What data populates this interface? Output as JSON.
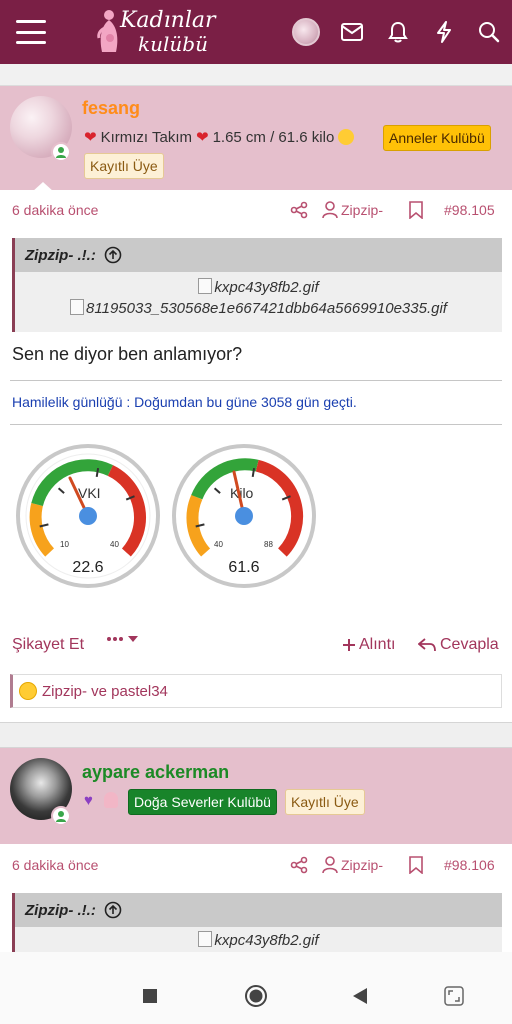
{
  "header": {
    "logo_line1": "Kadınlar",
    "logo_line2": "kulübü"
  },
  "posts": [
    {
      "username": "fesang",
      "username_color": "#ff8c1a",
      "title_text": "Kırmızı Takım",
      "title_stats": "1.65 cm / 61.6 kilo",
      "badges": [
        "Anneler Kulübü",
        "Kayıtlı Üye"
      ],
      "time": "6 dakika önce",
      "tagged_user": "Zipzip-",
      "post_number": "#98.105",
      "quote": {
        "author": "Zipzip- .!.:",
        "images": [
          "kxpc43y8fb2.gif",
          "81195033_530568e1e667421dbb64a5669910e335.gif"
        ]
      },
      "message": "Sen ne diyor ben anlamıyor?",
      "signature": "Hamilelik günlüğü : Doğumdan bu güne 3058 gün geçti.",
      "gauges": [
        {
          "label": "VKI",
          "value": "22.6",
          "min": "10",
          "max": "40",
          "needle": 22.6,
          "range": [
            10,
            40
          ]
        },
        {
          "label": "Kilo",
          "value": "61.6",
          "min": "40",
          "max": "88",
          "needle": 61.6,
          "range": [
            40,
            88
          ]
        }
      ],
      "actions": {
        "report": "Şikayet Et",
        "quote": "Alıntı",
        "reply": "Cevapla"
      },
      "reactions": "Zipzip- ve pastel34"
    },
    {
      "username": "aypare ackerman",
      "username_color": "#1c8a26",
      "badges": [
        "Doğa Severler Kulübü",
        "Kayıtlı Üye"
      ],
      "time": "6 dakika önce",
      "tagged_user": "Zipzip-",
      "post_number": "#98.106",
      "quote": {
        "author": "Zipzip- .!.:",
        "images": [
          "kxpc43y8fb2.gif"
        ]
      }
    }
  ],
  "colors": {
    "header_bg": "#7a1f45",
    "user_bar_bg": "#e5bfcc",
    "link": "#a2365c"
  }
}
